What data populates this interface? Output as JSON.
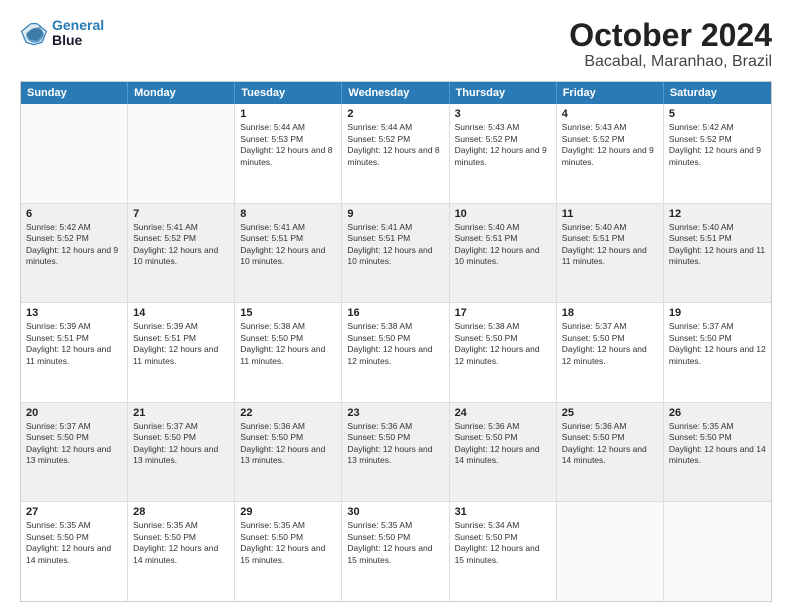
{
  "logo": {
    "line1": "General",
    "line2": "Blue"
  },
  "title": "October 2024",
  "subtitle": "Bacabal, Maranhao, Brazil",
  "header_days": [
    "Sunday",
    "Monday",
    "Tuesday",
    "Wednesday",
    "Thursday",
    "Friday",
    "Saturday"
  ],
  "weeks": [
    [
      {
        "day": "",
        "sunrise": "",
        "sunset": "",
        "daylight": "",
        "empty": true
      },
      {
        "day": "",
        "sunrise": "",
        "sunset": "",
        "daylight": "",
        "empty": true
      },
      {
        "day": "1",
        "sunrise": "Sunrise: 5:44 AM",
        "sunset": "Sunset: 5:53 PM",
        "daylight": "Daylight: 12 hours and 8 minutes.",
        "empty": false
      },
      {
        "day": "2",
        "sunrise": "Sunrise: 5:44 AM",
        "sunset": "Sunset: 5:52 PM",
        "daylight": "Daylight: 12 hours and 8 minutes.",
        "empty": false
      },
      {
        "day": "3",
        "sunrise": "Sunrise: 5:43 AM",
        "sunset": "Sunset: 5:52 PM",
        "daylight": "Daylight: 12 hours and 9 minutes.",
        "empty": false
      },
      {
        "day": "4",
        "sunrise": "Sunrise: 5:43 AM",
        "sunset": "Sunset: 5:52 PM",
        "daylight": "Daylight: 12 hours and 9 minutes.",
        "empty": false
      },
      {
        "day": "5",
        "sunrise": "Sunrise: 5:42 AM",
        "sunset": "Sunset: 5:52 PM",
        "daylight": "Daylight: 12 hours and 9 minutes.",
        "empty": false
      }
    ],
    [
      {
        "day": "6",
        "sunrise": "Sunrise: 5:42 AM",
        "sunset": "Sunset: 5:52 PM",
        "daylight": "Daylight: 12 hours and 9 minutes.",
        "empty": false
      },
      {
        "day": "7",
        "sunrise": "Sunrise: 5:41 AM",
        "sunset": "Sunset: 5:52 PM",
        "daylight": "Daylight: 12 hours and 10 minutes.",
        "empty": false
      },
      {
        "day": "8",
        "sunrise": "Sunrise: 5:41 AM",
        "sunset": "Sunset: 5:51 PM",
        "daylight": "Daylight: 12 hours and 10 minutes.",
        "empty": false
      },
      {
        "day": "9",
        "sunrise": "Sunrise: 5:41 AM",
        "sunset": "Sunset: 5:51 PM",
        "daylight": "Daylight: 12 hours and 10 minutes.",
        "empty": false
      },
      {
        "day": "10",
        "sunrise": "Sunrise: 5:40 AM",
        "sunset": "Sunset: 5:51 PM",
        "daylight": "Daylight: 12 hours and 10 minutes.",
        "empty": false
      },
      {
        "day": "11",
        "sunrise": "Sunrise: 5:40 AM",
        "sunset": "Sunset: 5:51 PM",
        "daylight": "Daylight: 12 hours and 11 minutes.",
        "empty": false
      },
      {
        "day": "12",
        "sunrise": "Sunrise: 5:40 AM",
        "sunset": "Sunset: 5:51 PM",
        "daylight": "Daylight: 12 hours and 11 minutes.",
        "empty": false
      }
    ],
    [
      {
        "day": "13",
        "sunrise": "Sunrise: 5:39 AM",
        "sunset": "Sunset: 5:51 PM",
        "daylight": "Daylight: 12 hours and 11 minutes.",
        "empty": false
      },
      {
        "day": "14",
        "sunrise": "Sunrise: 5:39 AM",
        "sunset": "Sunset: 5:51 PM",
        "daylight": "Daylight: 12 hours and 11 minutes.",
        "empty": false
      },
      {
        "day": "15",
        "sunrise": "Sunrise: 5:38 AM",
        "sunset": "Sunset: 5:50 PM",
        "daylight": "Daylight: 12 hours and 11 minutes.",
        "empty": false
      },
      {
        "day": "16",
        "sunrise": "Sunrise: 5:38 AM",
        "sunset": "Sunset: 5:50 PM",
        "daylight": "Daylight: 12 hours and 12 minutes.",
        "empty": false
      },
      {
        "day": "17",
        "sunrise": "Sunrise: 5:38 AM",
        "sunset": "Sunset: 5:50 PM",
        "daylight": "Daylight: 12 hours and 12 minutes.",
        "empty": false
      },
      {
        "day": "18",
        "sunrise": "Sunrise: 5:37 AM",
        "sunset": "Sunset: 5:50 PM",
        "daylight": "Daylight: 12 hours and 12 minutes.",
        "empty": false
      },
      {
        "day": "19",
        "sunrise": "Sunrise: 5:37 AM",
        "sunset": "Sunset: 5:50 PM",
        "daylight": "Daylight: 12 hours and 12 minutes.",
        "empty": false
      }
    ],
    [
      {
        "day": "20",
        "sunrise": "Sunrise: 5:37 AM",
        "sunset": "Sunset: 5:50 PM",
        "daylight": "Daylight: 12 hours and 13 minutes.",
        "empty": false
      },
      {
        "day": "21",
        "sunrise": "Sunrise: 5:37 AM",
        "sunset": "Sunset: 5:50 PM",
        "daylight": "Daylight: 12 hours and 13 minutes.",
        "empty": false
      },
      {
        "day": "22",
        "sunrise": "Sunrise: 5:36 AM",
        "sunset": "Sunset: 5:50 PM",
        "daylight": "Daylight: 12 hours and 13 minutes.",
        "empty": false
      },
      {
        "day": "23",
        "sunrise": "Sunrise: 5:36 AM",
        "sunset": "Sunset: 5:50 PM",
        "daylight": "Daylight: 12 hours and 13 minutes.",
        "empty": false
      },
      {
        "day": "24",
        "sunrise": "Sunrise: 5:36 AM",
        "sunset": "Sunset: 5:50 PM",
        "daylight": "Daylight: 12 hours and 14 minutes.",
        "empty": false
      },
      {
        "day": "25",
        "sunrise": "Sunrise: 5:36 AM",
        "sunset": "Sunset: 5:50 PM",
        "daylight": "Daylight: 12 hours and 14 minutes.",
        "empty": false
      },
      {
        "day": "26",
        "sunrise": "Sunrise: 5:35 AM",
        "sunset": "Sunset: 5:50 PM",
        "daylight": "Daylight: 12 hours and 14 minutes.",
        "empty": false
      }
    ],
    [
      {
        "day": "27",
        "sunrise": "Sunrise: 5:35 AM",
        "sunset": "Sunset: 5:50 PM",
        "daylight": "Daylight: 12 hours and 14 minutes.",
        "empty": false
      },
      {
        "day": "28",
        "sunrise": "Sunrise: 5:35 AM",
        "sunset": "Sunset: 5:50 PM",
        "daylight": "Daylight: 12 hours and 14 minutes.",
        "empty": false
      },
      {
        "day": "29",
        "sunrise": "Sunrise: 5:35 AM",
        "sunset": "Sunset: 5:50 PM",
        "daylight": "Daylight: 12 hours and 15 minutes.",
        "empty": false
      },
      {
        "day": "30",
        "sunrise": "Sunrise: 5:35 AM",
        "sunset": "Sunset: 5:50 PM",
        "daylight": "Daylight: 12 hours and 15 minutes.",
        "empty": false
      },
      {
        "day": "31",
        "sunrise": "Sunrise: 5:34 AM",
        "sunset": "Sunset: 5:50 PM",
        "daylight": "Daylight: 12 hours and 15 minutes.",
        "empty": false
      },
      {
        "day": "",
        "sunrise": "",
        "sunset": "",
        "daylight": "",
        "empty": true
      },
      {
        "day": "",
        "sunrise": "",
        "sunset": "",
        "daylight": "",
        "empty": true
      }
    ]
  ],
  "colors": {
    "header_bg": "#2a7ab5",
    "header_text": "#ffffff",
    "border": "#cccccc",
    "shaded_row": "#f0f0f0"
  }
}
